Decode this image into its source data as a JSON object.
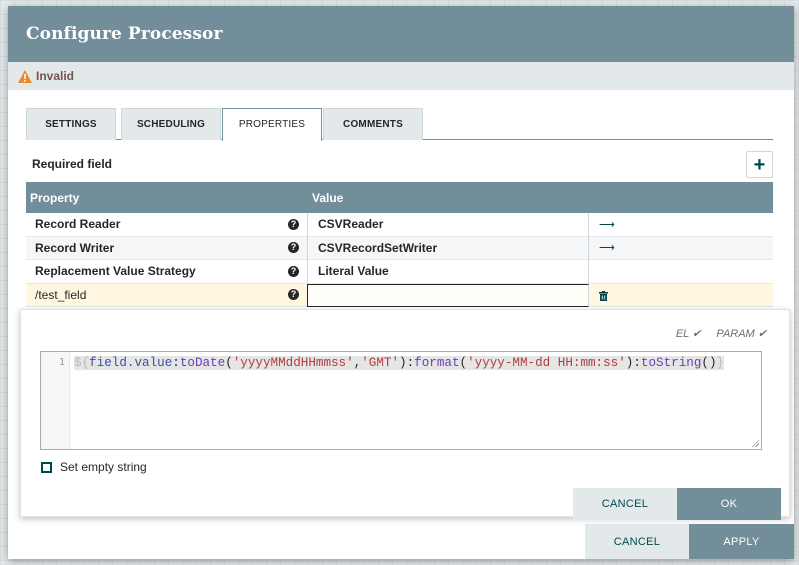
{
  "dialog": {
    "title": "Configure Processor",
    "status": "Invalid"
  },
  "tabs": [
    {
      "label": "SETTINGS"
    },
    {
      "label": "SCHEDULING"
    },
    {
      "label": "PROPERTIES",
      "active": true
    },
    {
      "label": "COMMENTS"
    }
  ],
  "properties": {
    "required_label": "Required field",
    "add_label": "+",
    "headers": {
      "property": "Property",
      "value": "Value"
    },
    "rows": [
      {
        "name": "Record Reader",
        "value": "CSVReader",
        "action": "arrow-right-icon"
      },
      {
        "name": "Record Writer",
        "value": "CSVRecordSetWriter",
        "action": "arrow-right-icon"
      },
      {
        "name": "Replacement Value Strategy",
        "value": "Literal Value",
        "action": ""
      },
      {
        "name": "/test_field",
        "value": "",
        "action": "trash-icon"
      }
    ],
    "help_glyph": "?",
    "arrow_glyph": "⟶",
    "trash_glyph": "🗑"
  },
  "editor": {
    "el_label": "EL ✔",
    "param_label": "PARAM ✔",
    "line_number": "1",
    "code_tokens": {
      "t1": "${",
      "t2": "field.value",
      "t3": ":",
      "t4": "toDate",
      "t5": "(",
      "t6": "'yyyyMMddHHmmss'",
      "t7": ",",
      "t8": "'GMT'",
      "t9": "):",
      "t10": "format",
      "t11": "(",
      "t12": "'yyyy-MM-dd HH:mm:ss'",
      "t13": "):",
      "t14": "toString",
      "t15": "()",
      "t16": "}"
    },
    "set_empty_label": "Set empty string",
    "cancel_label": "CANCEL",
    "ok_label": "OK"
  },
  "footer": {
    "cancel_label": "CANCEL",
    "apply_label": "APPLY"
  },
  "colors": {
    "header": "#728e9b",
    "accent": "#004849",
    "warning": "#e98a2b"
  }
}
